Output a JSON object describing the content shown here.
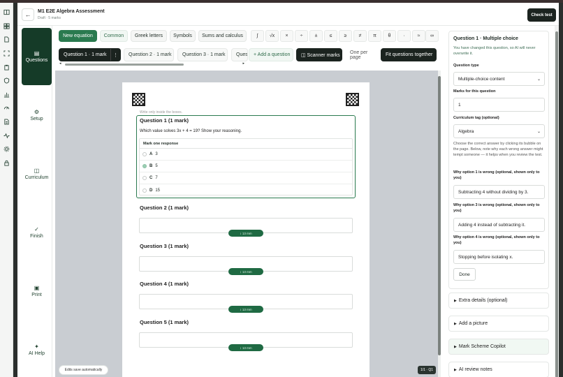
{
  "header": {
    "back_label": "←",
    "title": "M1 E2E Algebra Assessment",
    "subtitle": "Draft · 5 marks",
    "check_test_label": "Check test"
  },
  "rail_icons": [
    "book-icon",
    "grid-icon",
    "document-icon",
    "scan-icon",
    "clipboard-icon",
    "shield-icon",
    "chart-icon",
    "gauge-icon",
    "file-icon",
    "pulse-icon",
    "gear-icon",
    "lock-icon"
  ],
  "sidenav": {
    "items": [
      {
        "icon": "▤",
        "label": "Questions"
      },
      {
        "icon": "⚙",
        "label": "Setup"
      },
      {
        "icon": "◫",
        "label": "Curriculum"
      },
      {
        "icon": "✓",
        "label": "Finish"
      },
      {
        "icon": "▣",
        "label": "Print"
      },
      {
        "icon": "✦",
        "label": "AI Help"
      }
    ]
  },
  "toolbar": {
    "new_equation": "New equation",
    "common": "Common",
    "greek": "Greek letters",
    "symbols": "Symbols",
    "sums": "Sums and calculus",
    "syms": [
      "∫",
      "√x",
      "×",
      "÷",
      "±",
      "≤",
      "≥",
      "≠",
      "π",
      "θ",
      "·",
      "≈",
      "∞"
    ]
  },
  "tabs": {
    "items": [
      "Question 1 · 1 mark",
      "Question 2 · 1 mark",
      "Question 3 · 1 mark",
      "Ques"
    ],
    "add_question": "+ Add a question",
    "scanner_marks": "◫ Scanner marks",
    "one_per_page": "One per page",
    "fit_together": "Fit questions together",
    "scroll_left": "◂",
    "scroll_right": "▸"
  },
  "paper": {
    "write_only": "Write only inside the boxes.",
    "q1": {
      "title": "Question 1 (1 mark)",
      "text": "Which value solves 3x + 4 = 19? Show your reasoning.",
      "mark_one": "Mark one response",
      "options": [
        {
          "letter": "A",
          "value": "3"
        },
        {
          "letter": "B",
          "value": "5"
        },
        {
          "letter": "C",
          "value": "7"
        },
        {
          "letter": "D",
          "value": "15"
        }
      ],
      "selected": "B"
    },
    "questions": [
      {
        "title": "Question 2 (1 mark)",
        "height": "↕ 13 mm"
      },
      {
        "title": "Question 3 (1 mark)",
        "height": "↕ 13 mm"
      },
      {
        "title": "Question 4 (1 mark)",
        "height": "↕ 13 mm"
      },
      {
        "title": "Question 5 (1 mark)",
        "height": "↕ 13 mm"
      }
    ]
  },
  "autosave": "Edits save automatically",
  "page_badge": "1/1 · Q1",
  "panel": {
    "title": "Question 1 · Multiple choice",
    "note": "You have changed this question, so AI will never overwrite it.",
    "qtype_label": "Question type",
    "qtype_value": "Multiple-choice content",
    "marks_label": "Marks for this question",
    "marks_value": "1",
    "tag_label": "Curriculum tag (optional)",
    "tag_value": "Algebra",
    "hint": "Choose the correct answer by clicking its bubble on the page. Below, note why each wrong answer might tempt someone — it helps when you review the test.",
    "why1_label": "Why option 1 is wrong (optional, shown only to you)",
    "why1_value": "Subtracting 4 without dividing by 3.",
    "why3_label": "Why option 3 is wrong (optional, shown only to you)",
    "why3_value": "Adding 4 instead of subtracting it.",
    "why4_label": "Why option 4 is wrong (optional, shown only to you)",
    "why4_value": "Stopping before isolating x.",
    "done": "Done",
    "extra": "Extra details (optional)",
    "picture": "Add a picture",
    "copilot": "Mark Scheme Copilot",
    "ai_review": "AI review notes"
  },
  "colors": {
    "accent": "#2a7a4f",
    "dark": "#1b231f",
    "nav_active": "#153b28"
  }
}
